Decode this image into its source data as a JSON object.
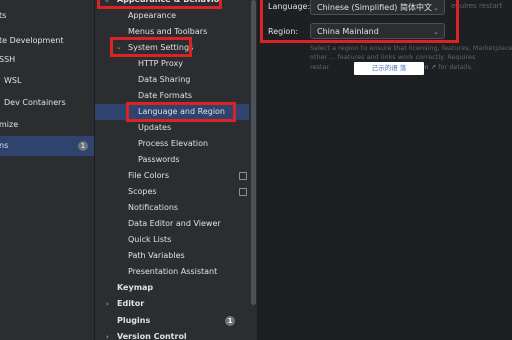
{
  "left_panel": {
    "items": [
      {
        "label": "ts"
      },
      {
        "label": "te Development"
      },
      {
        "label": "SSH"
      },
      {
        "label": "WSL"
      },
      {
        "label": "Dev Containers"
      },
      {
        "label": "mize"
      },
      {
        "label": "ns",
        "badge": "1"
      }
    ]
  },
  "tree": {
    "appearance_header": "Appearance & Behavior",
    "appearance": "Appearance",
    "menus_toolbars": "Menus and Toolbars",
    "system_settings": "System Settings",
    "http_proxy": "HTTP Proxy",
    "data_sharing": "Data Sharing",
    "date_formats": "Date Formats",
    "language_region": "Language and Region",
    "updates": "Updates",
    "process_elevation": "Process Elevation",
    "passwords": "Passwords",
    "file_colors": "File Colors",
    "scopes": "Scopes",
    "notifications": "Notifications",
    "data_editor": "Data Editor and Viewer",
    "quick_lists": "Quick Lists",
    "path_variables": "Path Variables",
    "presentation_assistant": "Presentation Assistant",
    "keymap": "Keymap",
    "editor": "Editor",
    "plugins": "Plugins",
    "plugins_badge": "1",
    "version_control": "Version Control"
  },
  "settings": {
    "language_label": "Language:",
    "language_value": "Chinese (Simplified) 简体中文",
    "language_hint": "equires restart",
    "region_label": "Region:",
    "region_value": "China Mainland",
    "region_hint_1": "Select a region to ensure that licensing, features, Marketplace,",
    "region_hint_2": "other ... features and links work correctly. Requires",
    "region_hint_3_prefix": "restar",
    "region_hint_3_link": "mentation ↗",
    "region_hint_3_suffix": "for details.",
    "tooltip": "己示的语 落"
  },
  "colors": {
    "accent_selection": "#2e436e",
    "highlight_border": "#d92424",
    "link": "#5a8fd8"
  }
}
